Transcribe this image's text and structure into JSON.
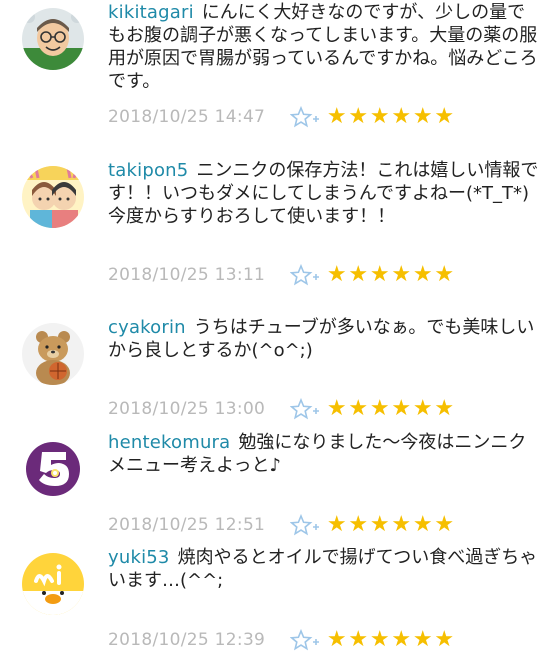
{
  "comments": [
    {
      "username": "kikitagari",
      "text": "にんにく大好きなのですが、少しの量でもお腹の調子が悪くなってしまいます。大量の薬の服用が原因で胃腸が弱っているんですかね。悩みどころです。",
      "timestamp": "2018/10/25 14:47",
      "avatar": "avatar-glasses-man",
      "stars": "★★★★★★"
    },
    {
      "username": "takipon5",
      "text": "ニンニクの保存方法！これは嬉しい情報です！！いつもダメにしてしまうんですよねー(*T_T*)今度からすりおろして使います！！",
      "timestamp": "2018/10/25 13:11",
      "avatar": "avatar-illustration-couple",
      "stars": "★★★★★★"
    },
    {
      "username": "cyakorin",
      "text": "うちはチューブが多いなぁ。でも美味しいから良しとするか(^o^;)",
      "timestamp": "2018/10/25 13:00",
      "avatar": "avatar-teddy-bear",
      "stars": "★★★★★★"
    },
    {
      "username": "hentekomura",
      "text": "勉強になりました～今夜はニンニクメニュー考えよっと♪",
      "timestamp": "2018/10/25 12:51",
      "avatar": "avatar-number-5",
      "stars": "★★★★★★"
    },
    {
      "username": "yuki53",
      "text": "焼肉やるとオイルで揚げてつい食べ過ぎちゃいます…(^^;",
      "timestamp": "2018/10/25 12:39",
      "avatar": "avatar-mi-chick",
      "stars": "★★★★★★"
    }
  ],
  "colors": {
    "username": "#1f8aa8",
    "star": "#f6bf00",
    "timestamp": "#b9b9b9",
    "fav_icon": "#9ec6e8"
  },
  "icons": {
    "favorite": "star-plus-icon",
    "rating": "star-icon"
  }
}
